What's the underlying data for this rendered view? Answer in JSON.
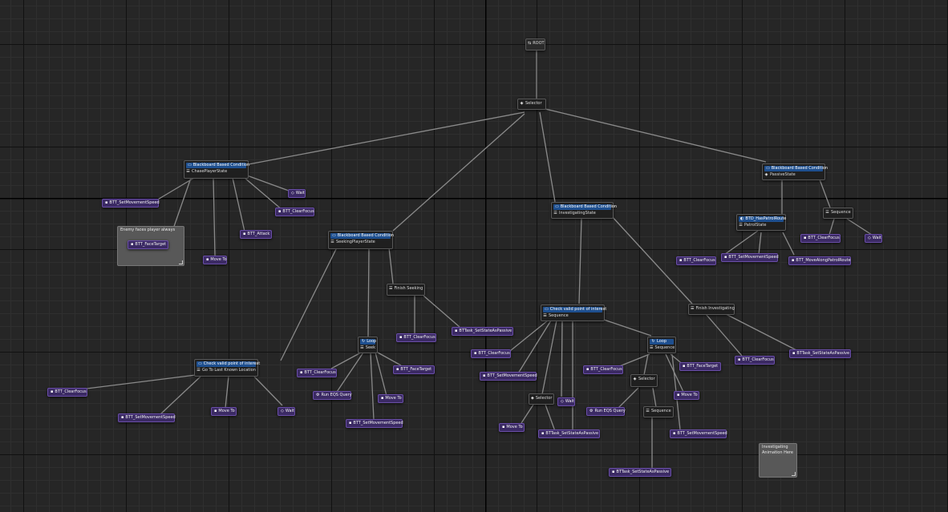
{
  "graph": {
    "root": "ROOT",
    "nodes": {
      "selector_main": "Selector",
      "chase_deco": "Blackboard Based Condition",
      "chase_name": "ChasePlayerState",
      "seek_deco": "Blackboard Based Condition",
      "seek_name": "SeekingPlayerState",
      "invest_deco": "Blackboard Based Condition",
      "invest_name": "InvestigatingState",
      "passive_deco": "Blackboard Based Condition",
      "passive_name": "PassiveState",
      "patrol_deco": "BTD_HasPatrolRoute",
      "patrol_name": "PatrolState",
      "passive_sequence": "Sequence",
      "finish_seeking": "Finish Seeking",
      "finish_investigating": "Finish Investigating",
      "seek_loop_deco": "Loop",
      "seek_loop_name": "Seek",
      "check_last_deco": "Check valid point of interest",
      "check_last_name": "Go To Last Known Location",
      "check_invest_deco": "Check valid point of interest",
      "check_invest_name": "Sequence",
      "loop_seq_deco": "Loop",
      "loop_seq_name": "Sequence",
      "inv_selector_a": "Selector",
      "inv_selector_b": "Selector",
      "inv_sequence": "Sequence"
    },
    "tasks": {
      "chase_setspeed": "BTT_SetMovementSpeed",
      "chase_facetarget": "BTT_FaceTarget",
      "chase_moveto": "Move To",
      "chase_attack": "BTT_Attack",
      "chase_clearfocus": "BTT_ClearFocus",
      "chase_wait": "Wait",
      "patrol_clearfocus": "BTT_ClearFocus",
      "patrol_setspeed": "BTT_SetMovementSpeed",
      "patrol_moveroute": "BTT_MoveAlongPatrolRoute",
      "passive_clearfocus": "BTT_ClearFocus",
      "passive_wait": "Wait",
      "seek_clearfocus": "BTT_ClearFocus",
      "seek_setpassive": "BTTask_SetStateAsPassive",
      "seek_loop_clearfocus": "BTT_ClearFocus",
      "seek_facetarget": "BTT_FaceTarget",
      "seek_eqs": "Run EQS Query",
      "seek_moveto": "Move To",
      "seek_setspeed": "BTT_SetMovementSpeed",
      "last_clearfocus": "BTT_ClearFocus",
      "last_setspeed": "BTT_SetMovementSpeed",
      "last_moveto": "Move To",
      "last_wait": "Wait",
      "inv_clearfocus": "BTT_ClearFocus",
      "inv_setspeed": "BTT_SetMovementSpeed",
      "inv_moveto": "Move To",
      "inv_setpassive_a": "BTTask_SetStateAsPassive",
      "inv_wait": "Wait",
      "loop_clearfocus": "BTT_ClearFocus",
      "loop_facetarget": "BTT_FaceTarget",
      "loop_eqs": "Run EQS Query",
      "loop_moveto": "Move To",
      "loop_setpassive": "BTTask_SetStateAsPassive",
      "loop_setspeed": "BTT_SetMovementSpeed",
      "finv_clearfocus": "BTT_ClearFocus",
      "finv_setpassive": "BTTask_SetStateAsPassive"
    },
    "comments": {
      "enemy_face": "Enemy faces player always",
      "invest_anim": "Investigating Animation Here"
    }
  }
}
